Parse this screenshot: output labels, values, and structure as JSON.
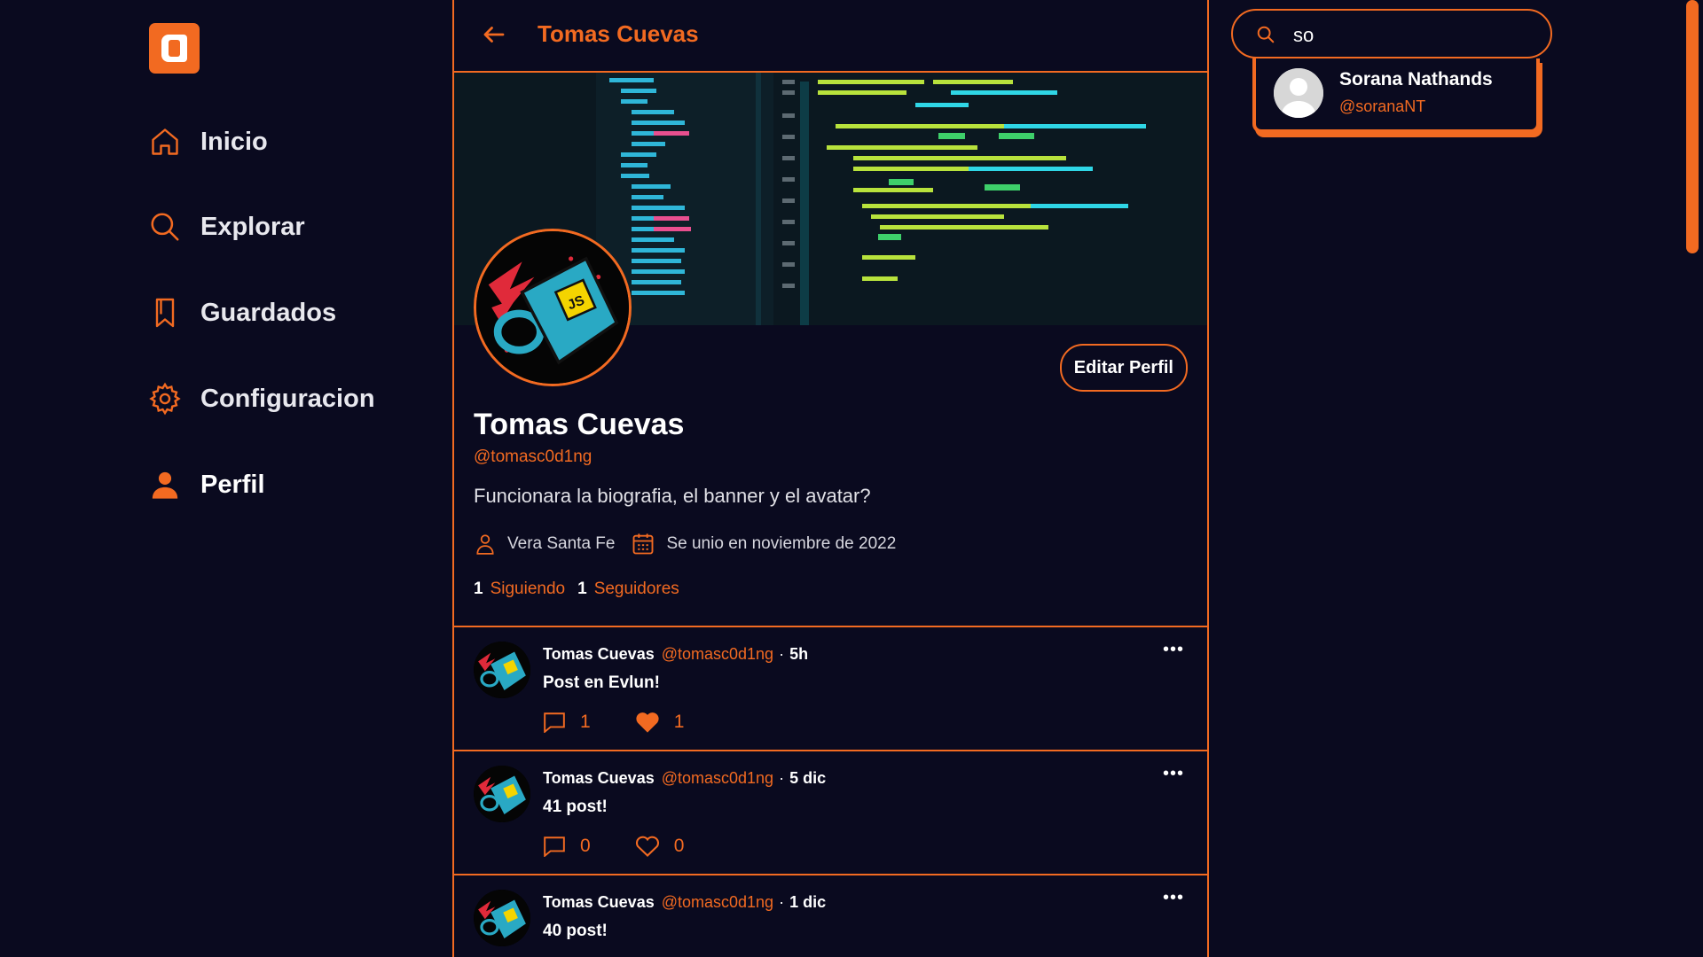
{
  "colors": {
    "accent": "#f26a21",
    "background": "#0a0a1f",
    "text": "#ffffff"
  },
  "sidebar": {
    "items": [
      {
        "label": "Inicio",
        "icon": "home-icon"
      },
      {
        "label": "Explorar",
        "icon": "search-icon"
      },
      {
        "label": "Guardados",
        "icon": "bookmark-icon"
      },
      {
        "label": "Configuracion",
        "icon": "gear-icon"
      },
      {
        "label": "Perfil",
        "icon": "user-icon",
        "active": true
      }
    ]
  },
  "header": {
    "title": "Tomas Cuevas"
  },
  "profile": {
    "name": "Tomas Cuevas",
    "handle": "@tomasc0d1ng",
    "bio": "Funcionara la biografia, el banner y el avatar?",
    "location": "Vera Santa Fe",
    "joined": "Se unio en noviembre de 2022",
    "following_count": "1",
    "following_label": "Siguiendo",
    "followers_count": "1",
    "followers_label": "Seguidores",
    "edit_label": "Editar Perfil"
  },
  "posts": [
    {
      "author": "Tomas Cuevas",
      "handle": "@tomasc0d1ng",
      "sep": "·",
      "time": "5h",
      "text": "Post en Evlun!",
      "comments": "1",
      "likes": "1",
      "liked": true
    },
    {
      "author": "Tomas Cuevas",
      "handle": "@tomasc0d1ng",
      "sep": "·",
      "time": "5 dic",
      "text": "41 post!",
      "comments": "0",
      "likes": "0",
      "liked": false
    },
    {
      "author": "Tomas Cuevas",
      "handle": "@tomasc0d1ng",
      "sep": "·",
      "time": "1 dic",
      "text": "40 post!",
      "comments": "",
      "likes": "",
      "liked": false
    }
  ],
  "search": {
    "value": "so",
    "results": [
      {
        "name": "Sorana Nathands",
        "handle": "@soranaNT"
      }
    ]
  }
}
